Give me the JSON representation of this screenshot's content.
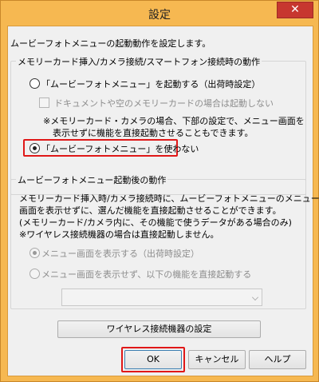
{
  "window": {
    "title": "設定",
    "close_glyph": "✕"
  },
  "intro": "ムービーフォトメニューの起動動作を設定します。",
  "group1": {
    "legend": "メモリーカード挿入/カメラ接続/スマートフォン接続時の動作",
    "radio_launch": {
      "label": "「ムービーフォトメニュー」を起動する（出荷時設定）",
      "checked": false
    },
    "checkbox_doc": {
      "label": "ドキュメントや空のメモリーカードの場合は起動しない",
      "checked": false,
      "enabled": false
    },
    "note_lines": [
      "※メモリーカード・カメラの場合、下部の設定で、メニュー画面を",
      "表示せずに機能を直接起動させることもできます。"
    ],
    "radio_not_use": {
      "label": "「ムービーフォトメニュー」を使わない",
      "checked": true
    }
  },
  "group2": {
    "legend": "ムービーフォトメニュー起動後の動作",
    "desc_lines": [
      "メモリーカード挿入時/カメラ接続時に、ムービーフォトメニューのメニュー",
      "画面を表示せずに、選んだ機能を直接起動させることができます。",
      "(メモリーカード/カメラ内に、その機能で使うデータがある場合のみ)",
      "※ワイヤレス接続機器の場合は直接起動しません。"
    ],
    "radio_show_menu": {
      "label": "メニュー画面を表示する（出荷時設定）",
      "checked": true,
      "enabled": false
    },
    "radio_direct": {
      "label": "メニュー画面を表示せず、以下の機能を直接起動する",
      "checked": false,
      "enabled": false
    },
    "function_select": {
      "value": "",
      "enabled": false
    }
  },
  "buttons": {
    "wireless": "ワイヤレス接続機器の設定",
    "ok": "OK",
    "cancel": "キャンセル",
    "help": "ヘルプ"
  },
  "colors": {
    "title_bar": "#f6b851",
    "close_button": "#c7372f",
    "highlight": "#e01818",
    "dialog_background": "#f0f0f0"
  }
}
